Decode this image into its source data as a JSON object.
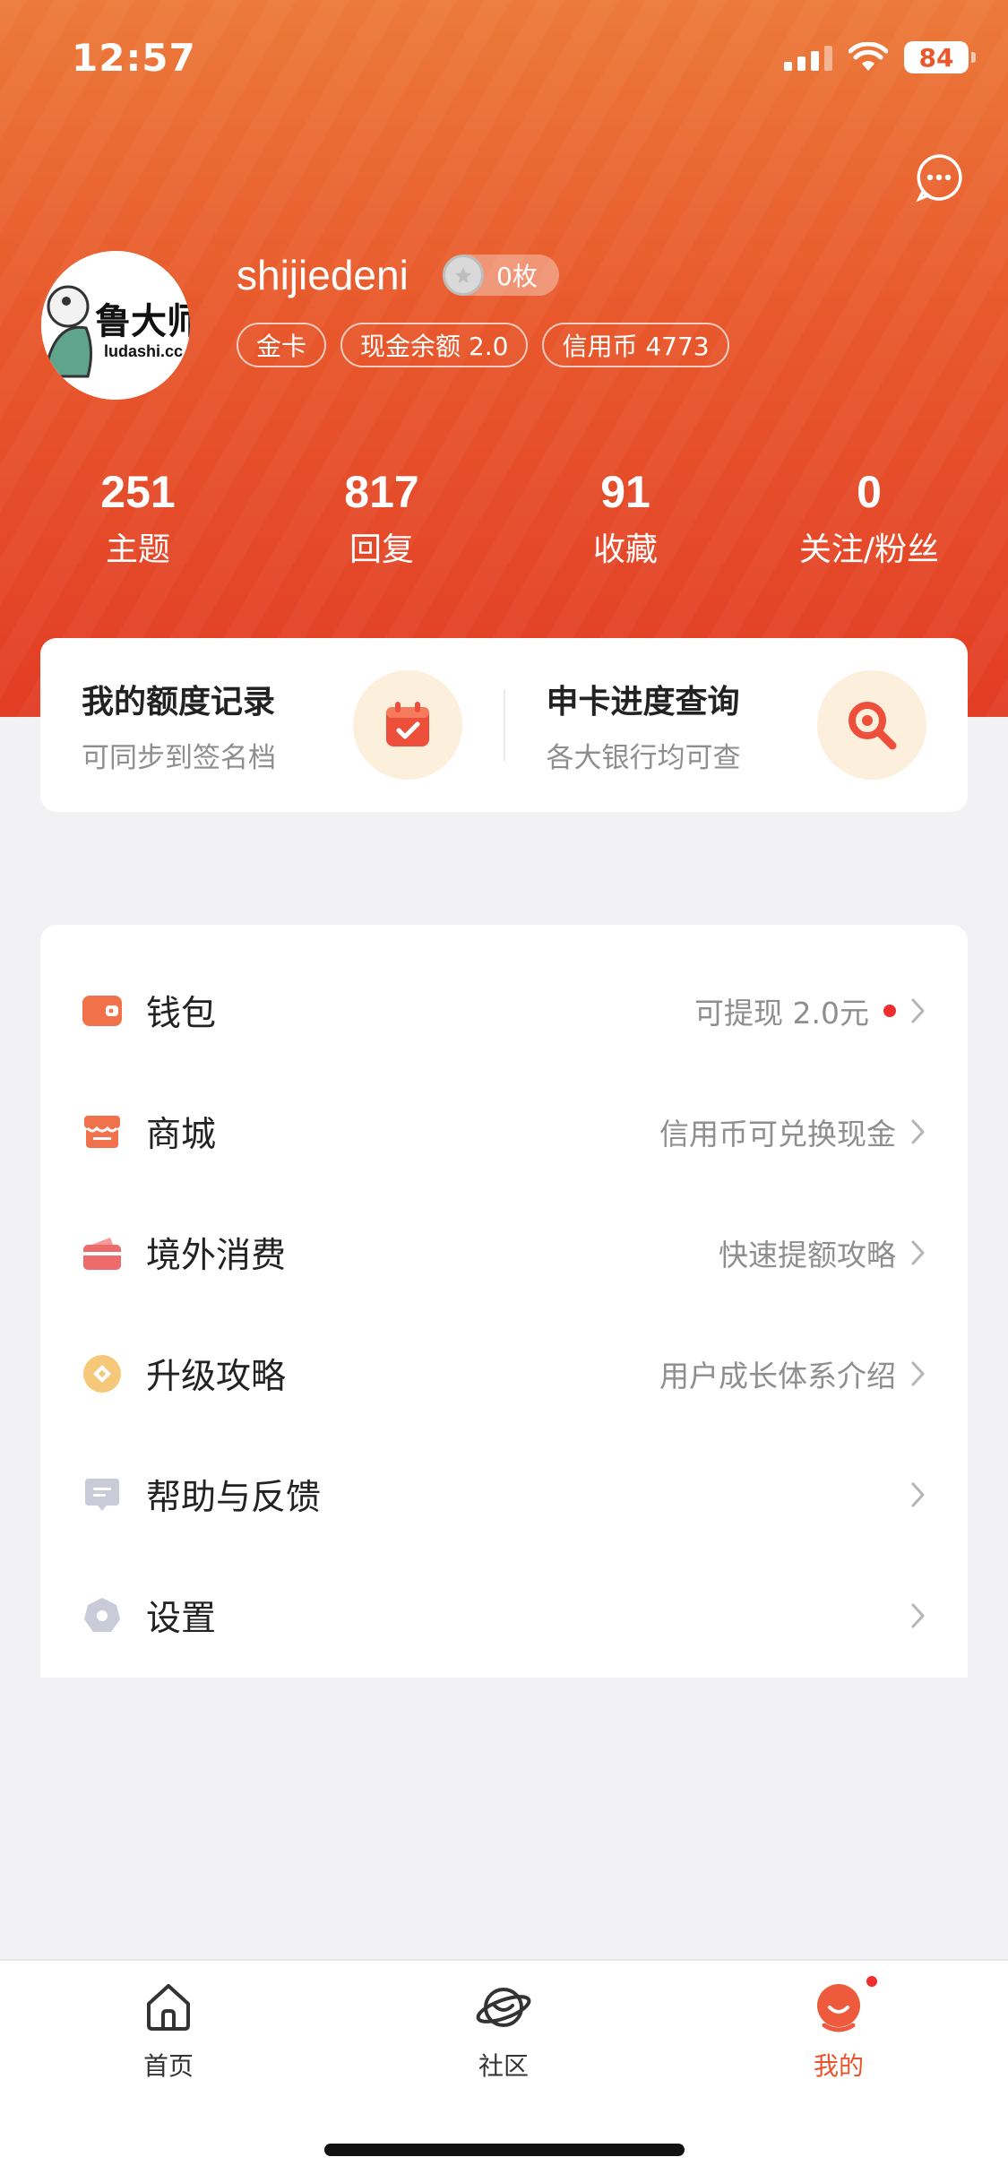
{
  "status": {
    "time": "12:57",
    "battery": "84"
  },
  "profile": {
    "username": "shijiedeni",
    "medal_count": "0枚",
    "avatar_text": "鲁大师",
    "avatar_sub": "ludashi.cc",
    "tags": [
      "金卡",
      "现金余额 2.0",
      "信用币 4773"
    ]
  },
  "stats": [
    {
      "value": "251",
      "label": "主题"
    },
    {
      "value": "817",
      "label": "回复"
    },
    {
      "value": "91",
      "label": "收藏"
    },
    {
      "value": "0",
      "label": "关注/粉丝"
    }
  ],
  "quick": [
    {
      "title": "我的额度记录",
      "sub": "可同步到签名档",
      "icon": "calendar-check-icon"
    },
    {
      "title": "申卡进度查询",
      "sub": "各大银行均可查",
      "icon": "magnifier-icon"
    }
  ],
  "menu": [
    {
      "label": "钱包",
      "desc": "可提现 2.0元",
      "icon": "wallet-icon",
      "dot": true
    },
    {
      "label": "商城",
      "desc": "信用币可兑换现金",
      "icon": "store-icon"
    },
    {
      "label": "境外消费",
      "desc": "快速提额攻略",
      "icon": "card-icon"
    },
    {
      "label": "升级攻略",
      "desc": "用户成长体系介绍",
      "icon": "coin-icon"
    },
    {
      "label": "帮助与反馈",
      "desc": "",
      "icon": "feedback-icon"
    },
    {
      "label": "设置",
      "desc": "",
      "icon": "settings-icon"
    }
  ],
  "tabs": [
    {
      "label": "首页",
      "icon": "home-icon"
    },
    {
      "label": "社区",
      "icon": "planet-icon"
    },
    {
      "label": "我的",
      "icon": "profile-icon",
      "active": true
    }
  ],
  "colors": {
    "accent": "#e8542c",
    "hero_top": "#ec7a3a",
    "hero_bottom": "#e23d26"
  }
}
